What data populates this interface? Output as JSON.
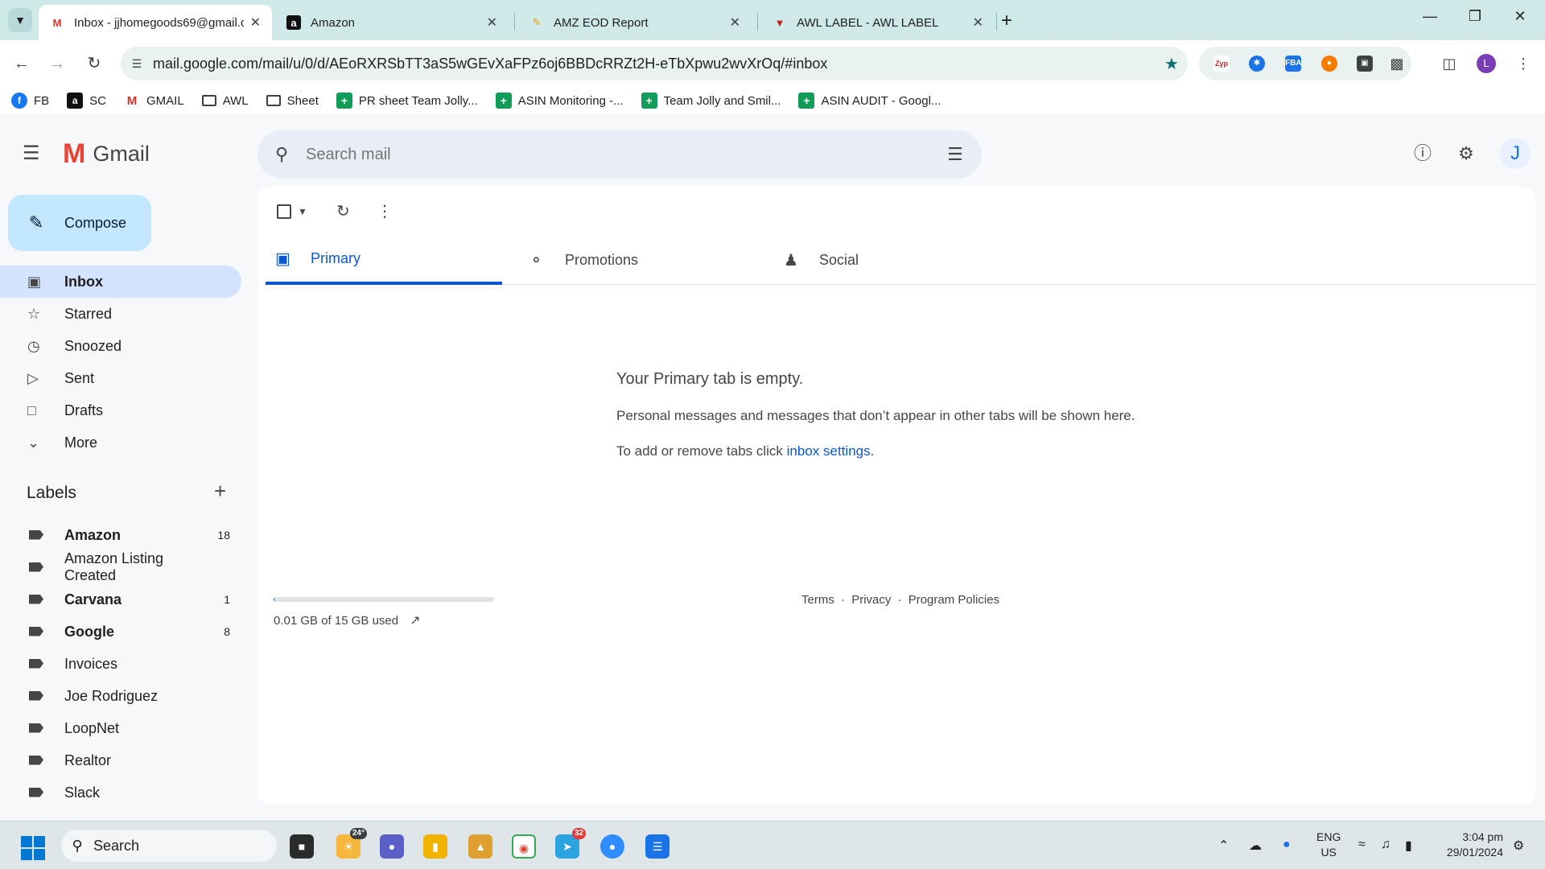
{
  "browser": {
    "tabs": [
      {
        "title": "Inbox - jjhomegoods69@gmail.com",
        "favicon": "gmail-icon",
        "active": true
      },
      {
        "title": "Amazon",
        "favicon": "amazon-icon",
        "active": false
      },
      {
        "title": "AMZ EOD Report",
        "favicon": "report-icon",
        "active": false
      },
      {
        "title": "AWL LABEL - AWL LABEL",
        "favicon": "awl-icon",
        "active": false
      }
    ],
    "url": "mail.google.com/mail/u/0/d/AEoRXRSbTT3aS5wGEvXaFPz6oj6BBDcRRZt2H-eTbXpwu2wvXrOq/#inbox",
    "profile_initial": "L",
    "extensions": [
      "Zyp",
      "FBA"
    ],
    "bookmarks": [
      {
        "label": "FB",
        "icon": "facebook-icon"
      },
      {
        "label": "SC",
        "icon": "amazon-icon"
      },
      {
        "label": "GMAIL",
        "icon": "gmail-icon"
      },
      {
        "label": "AWL",
        "icon": "folder-icon"
      },
      {
        "label": "Sheet",
        "icon": "folder-icon"
      },
      {
        "label": "PR sheet Team Jolly...",
        "icon": "sheets-icon"
      },
      {
        "label": "ASIN Monitoring -...",
        "icon": "sheets-icon"
      },
      {
        "label": "Team Jolly and Smil...",
        "icon": "sheets-icon"
      },
      {
        "label": "ASIN AUDIT - Googl...",
        "icon": "sheets-icon"
      }
    ]
  },
  "gmail": {
    "logo_text": "Gmail",
    "search_placeholder": "Search mail",
    "avatar_initial": "J",
    "compose_label": "Compose",
    "nav": [
      {
        "label": "Inbox",
        "icon": "inbox-icon",
        "active": true
      },
      {
        "label": "Starred",
        "icon": "star-icon",
        "active": false
      },
      {
        "label": "Snoozed",
        "icon": "clock-icon",
        "active": false
      },
      {
        "label": "Sent",
        "icon": "send-icon",
        "active": false
      },
      {
        "label": "Drafts",
        "icon": "draft-icon",
        "active": false
      },
      {
        "label": "More",
        "icon": "chevron-down-icon",
        "active": false
      }
    ],
    "labels_title": "Labels",
    "labels": [
      {
        "name": "Amazon",
        "count": "18",
        "bold": true
      },
      {
        "name": "Amazon Listing Created",
        "count": "",
        "bold": false
      },
      {
        "name": "Carvana",
        "count": "1",
        "bold": true
      },
      {
        "name": "Google",
        "count": "8",
        "bold": true
      },
      {
        "name": "Invoices",
        "count": "",
        "bold": false
      },
      {
        "name": "Joe Rodriguez",
        "count": "",
        "bold": false
      },
      {
        "name": "LoopNet",
        "count": "",
        "bold": false
      },
      {
        "name": "Realtor",
        "count": "",
        "bold": false
      },
      {
        "name": "Slack",
        "count": "",
        "bold": false
      }
    ],
    "category_tabs": [
      {
        "label": "Primary",
        "icon": "inbox-icon",
        "active": true
      },
      {
        "label": "Promotions",
        "icon": "tag-icon",
        "active": false
      },
      {
        "label": "Social",
        "icon": "people-icon",
        "active": false
      }
    ],
    "empty": {
      "title": "Your Primary tab is empty.",
      "line1": "Personal messages and messages that don’t appear in other tabs will be shown here.",
      "line2_prefix": "To add or remove tabs click ",
      "line2_link": "inbox settings",
      "line2_suffix": "."
    },
    "storage": {
      "text": "0.01 GB of 15 GB used",
      "used_fraction": 0.001
    },
    "footer": {
      "terms": "Terms",
      "privacy": "Privacy",
      "policies": "Program Policies",
      "sep": "·"
    }
  },
  "taskbar": {
    "search_label": "Search",
    "weather": "24°",
    "telegram_badge": "32",
    "lang_top": "ENG",
    "lang_bottom": "US",
    "time": "3:04 pm",
    "date": "29/01/2024"
  }
}
